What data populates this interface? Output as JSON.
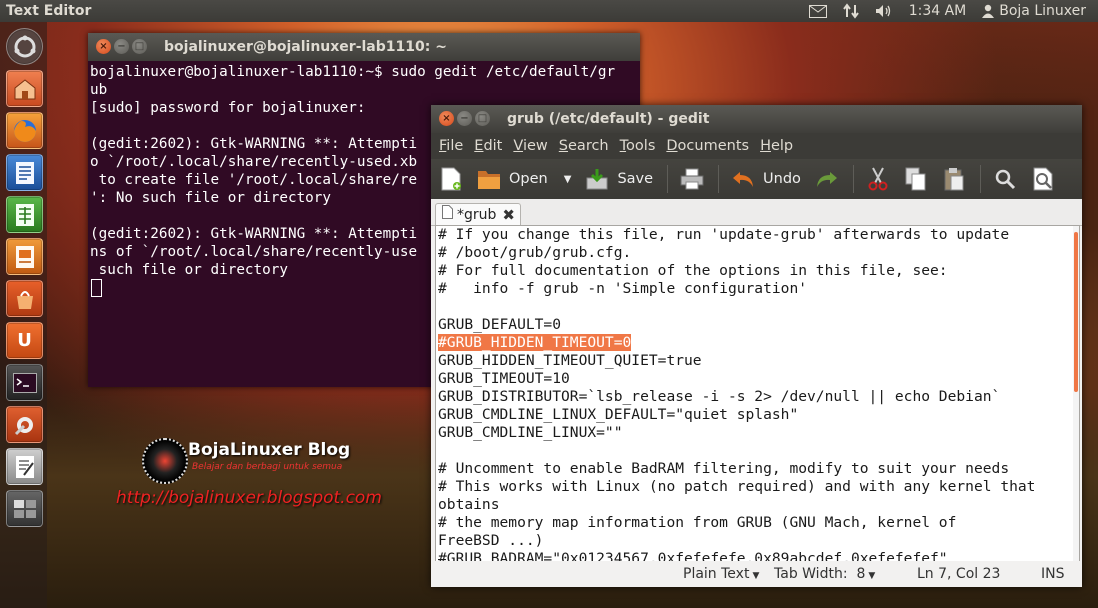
{
  "top_panel": {
    "app_title": "Text Editor",
    "time": "1:34 AM",
    "user": "Boja Linuxer",
    "icons": [
      "mail-icon",
      "network-icon",
      "volume-icon",
      "user-icon"
    ]
  },
  "launcher": {
    "items": [
      "dash-home-icon",
      "home-folder-icon",
      "firefox-icon",
      "writer-icon",
      "calc-icon",
      "impress-icon",
      "software-center-icon",
      "ubuntu-one-icon",
      "terminal-icon",
      "system-settings-icon",
      "text-editor-icon",
      "workspace-switcher-icon"
    ]
  },
  "terminal": {
    "title": "bojalinuxer@bojalinuxer-lab1110: ~",
    "lines": [
      "bojalinuxer@bojalinuxer-lab1110:~$ sudo gedit /etc/default/gr",
      "ub",
      "[sudo] password for bojalinuxer:",
      "",
      "(gedit:2602): Gtk-WARNING **: Attempti",
      "o `/root/.local/share/recently-used.xb",
      " to create file '/root/.local/share/re",
      "': No such file or directory",
      "",
      "(gedit:2602): Gtk-WARNING **: Attempti",
      "ns of `/root/.local/share/recently-use",
      " such file or directory"
    ]
  },
  "watermark": {
    "name": "BojaLinuxer Blog",
    "tagline": "Belajar dan berbagi untuk semua",
    "url": "http://bojalinuxer.blogspot.com"
  },
  "gedit": {
    "title": "grub (/etc/default) - gedit",
    "menu": [
      {
        "first": "F",
        "rest": "ile"
      },
      {
        "first": "E",
        "rest": "dit"
      },
      {
        "first": "V",
        "rest": "iew"
      },
      {
        "first": "S",
        "rest": "earch"
      },
      {
        "first": "T",
        "rest": "ools"
      },
      {
        "first": "D",
        "rest": "ocuments"
      },
      {
        "first": "H",
        "rest": "elp"
      }
    ],
    "toolbar": {
      "open_label": "Open",
      "save_label": "Save",
      "undo_label": "Undo"
    },
    "tab_label": "*grub",
    "lines": [
      "# If you change this file, run 'update-grub' afterwards to update",
      "# /boot/grub/grub.cfg.",
      "# For full documentation of the options in this file, see:",
      "#   info -f grub -n 'Simple configuration'",
      "",
      "GRUB_DEFAULT=0",
      "#GRUB_HIDDEN_TIMEOUT=0",
      "GRUB_HIDDEN_TIMEOUT_QUIET=true",
      "GRUB_TIMEOUT=10",
      "GRUB_DISTRIBUTOR=`lsb_release -i -s 2> /dev/null || echo Debian`",
      "GRUB_CMDLINE_LINUX_DEFAULT=\"quiet splash\"",
      "GRUB_CMDLINE_LINUX=\"\"",
      "",
      "# Uncomment to enable BadRAM filtering, modify to suit your needs",
      "# This works with Linux (no patch required) and with any kernel that",
      "obtains",
      "# the memory map information from GRUB (GNU Mach, kernel of",
      "FreeBSD ...)",
      "#GRUB_BADRAM=\"0x01234567,0xfefefefe,0x89abcdef,0xefefefef\""
    ],
    "highlight_line": 6,
    "status": {
      "language": "Plain Text",
      "tab_width": "Tab Width:  8",
      "position": "Ln 7, Col 23",
      "mode": "INS"
    }
  },
  "colors": {
    "terminal_bg": "#300a24",
    "selection": "#f07746",
    "panel": "#3c3b37"
  }
}
